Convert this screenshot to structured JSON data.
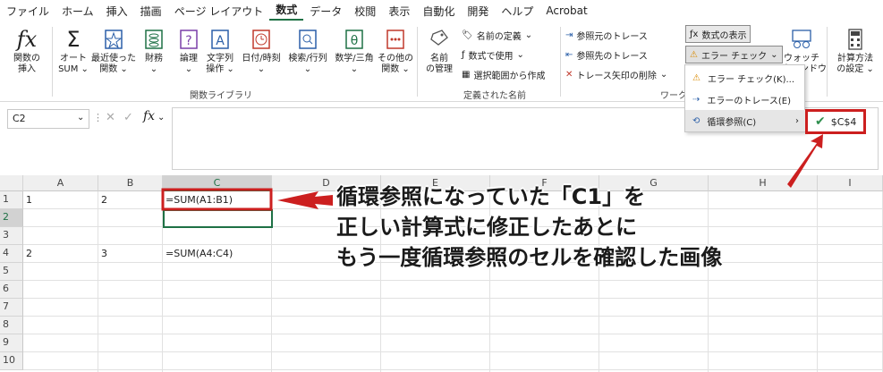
{
  "ribbon_tabs": [
    "ファイル",
    "ホーム",
    "挿入",
    "描画",
    "ページ レイアウト",
    "数式",
    "データ",
    "校閲",
    "表示",
    "自動化",
    "開発",
    "ヘルプ",
    "Acrobat"
  ],
  "active_tab": "数式",
  "function_library": {
    "insert_function": "関数の\n挿入",
    "autosum": "オート\nSUM ⌄",
    "recent": "最近使った\n関数 ⌄",
    "financial": "財務\n⌄",
    "logical": "論理\n⌄",
    "text": "文字列\n操作 ⌄",
    "datetime": "日付/時刻\n⌄",
    "lookup": "検索/行列\n⌄",
    "math": "数学/三角\n⌄",
    "more": "その他の\n関数 ⌄",
    "group_label": "関数ライブラリ"
  },
  "defined_names": {
    "name_manager": "名前\nの管理",
    "define_name": "名前の定義",
    "use_in_formula": "数式で使用",
    "create_from_selection": "選択範囲から作成",
    "group_label": "定義された名前"
  },
  "formula_auditing": {
    "trace_precedents": "参照元のトレース",
    "trace_dependents": "参照先のトレース",
    "remove_arrows": "トレース矢印の削除",
    "show_formulas": "数式の表示",
    "error_checking": "エラー チェック",
    "group_label_partial": "ワーク",
    "watch_window": "ウォッチ\nウィンドウ",
    "watch_tail": "ドウ"
  },
  "calculation": {
    "options": "計算方法\nの設定 ⌄"
  },
  "dropdown_menu": {
    "items": [
      "エラー チェック(K)...",
      "エラーのトレース(E)",
      "循環参照(C)"
    ],
    "submenu_value": "$C$4"
  },
  "formula_bar": {
    "name_box": "C2",
    "fx_label": "fx"
  },
  "grid": {
    "columns": [
      "A",
      "B",
      "C",
      "D",
      "E",
      "F",
      "G",
      "H",
      "I"
    ],
    "rows": [
      "1",
      "2",
      "3",
      "4",
      "5",
      "6",
      "7",
      "8",
      "9",
      "10"
    ],
    "cells": {
      "A1": "1",
      "B1": "2",
      "C1": "=SUM(A1:B1)",
      "A4": "2",
      "B4": "3",
      "C4": "=SUM(A4:C4)"
    }
  },
  "annotation": {
    "line1": "循環参照になっていた「C1」を",
    "line2": "正しい計算式に修正したあとに",
    "line3": "もう一度循環参照のセルを確認した画像"
  },
  "colors": {
    "accent_green": "#1e7145",
    "highlight_red": "#cc1f1f",
    "check_green": "#2f8f4e"
  }
}
